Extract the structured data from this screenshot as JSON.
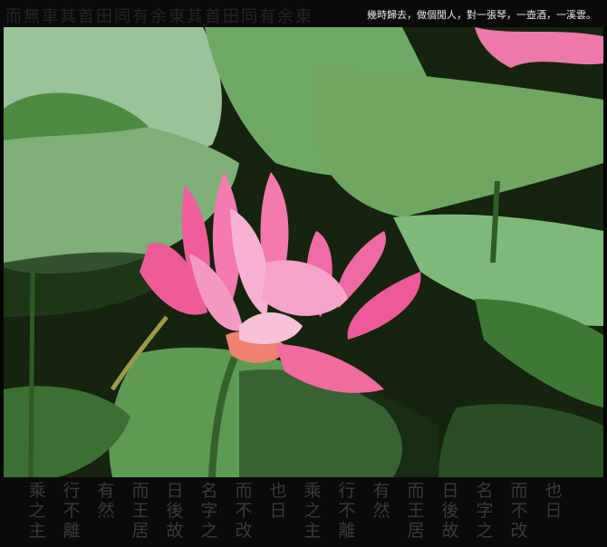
{
  "caption": "幾時歸去，做個閒人，對一張琴，一壺酒，一溪雲。",
  "seal_text": "而無車其首田同有余東其首田同有余東",
  "calligraphy_columns": [
    "乘之主",
    "行不離",
    "有然",
    "而王居",
    "日後故",
    "名字之",
    "而不改",
    "也日",
    "乘之主",
    "行不離",
    "有然",
    "而王居",
    "日後故",
    "名字之",
    "而不改",
    "也日"
  ],
  "colors": {
    "leaf_light": "#8fb88a",
    "leaf_dark": "#2f5a2a",
    "leaf_mid": "#5e9e55",
    "lotus_pink": "#f06aa0",
    "lotus_light": "#f7b8d2",
    "lotus_base": "#f08a7a",
    "stem": "#3c6a2a"
  },
  "icons": [
    "lotus-flower",
    "lotus-leaves"
  ]
}
